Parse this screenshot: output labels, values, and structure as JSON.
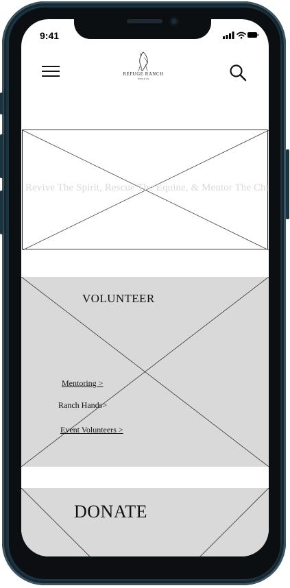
{
  "status_bar": {
    "time": "9:41"
  },
  "header": {
    "logo_text": "REFUGE RANCH",
    "logo_subtext": "WOULD US"
  },
  "hero": {
    "tagline": "Revive The Spirit, Rescue The Equine, & Mentor The Child"
  },
  "volunteer": {
    "title": "VOLUNTEER",
    "links": [
      {
        "label": "Mentoring >"
      },
      {
        "label": "Ranch Hands>"
      },
      {
        "label": "Event Volunteers >"
      }
    ]
  },
  "donate": {
    "title": "DONATE"
  },
  "colors": {
    "placeholder_gray": "#d9d9d9",
    "frame": "#1c3340"
  }
}
